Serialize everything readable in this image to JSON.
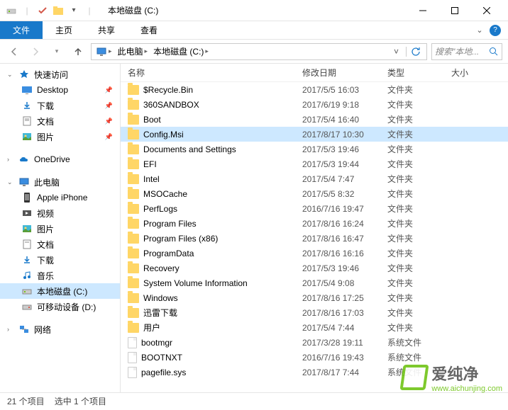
{
  "titlebar": {
    "title": "本地磁盘 (C:)",
    "min_tip": "最小化",
    "max_tip": "最大化",
    "close_tip": "关闭"
  },
  "ribbon": {
    "file": "文件",
    "home": "主页",
    "share": "共享",
    "view": "查看"
  },
  "path": {
    "seg1": "此电脑",
    "seg2": "本地磁盘 (C:)"
  },
  "search_placeholder": "搜索\"本地...",
  "nav": {
    "quick": "快速访问",
    "desktop": "Desktop",
    "downloads": "下载",
    "documents": "文档",
    "pictures": "图片",
    "onedrive": "OneDrive",
    "thispc": "此电脑",
    "apple": "Apple iPhone",
    "videos": "视频",
    "pictures2": "图片",
    "documents2": "文档",
    "downloads2": "下载",
    "music": "音乐",
    "cdrive": "本地磁盘 (C:)",
    "ddrive": "可移动设备 (D:)",
    "network": "网络"
  },
  "columns": {
    "name": "名称",
    "date": "修改日期",
    "type": "类型",
    "size": "大小"
  },
  "files": [
    {
      "name": "$Recycle.Bin",
      "date": "2017/5/5 16:03",
      "type": "文件夹",
      "icon": "folder"
    },
    {
      "name": "360SANDBOX",
      "date": "2017/6/19 9:18",
      "type": "文件夹",
      "icon": "folder"
    },
    {
      "name": "Boot",
      "date": "2017/5/4 16:40",
      "type": "文件夹",
      "icon": "folder"
    },
    {
      "name": "Config.Msi",
      "date": "2017/8/17 10:30",
      "type": "文件夹",
      "icon": "folder",
      "selected": true
    },
    {
      "name": "Documents and Settings",
      "date": "2017/5/3 19:46",
      "type": "文件夹",
      "icon": "folder"
    },
    {
      "name": "EFI",
      "date": "2017/5/3 19:44",
      "type": "文件夹",
      "icon": "folder"
    },
    {
      "name": "Intel",
      "date": "2017/5/4 7:47",
      "type": "文件夹",
      "icon": "folder"
    },
    {
      "name": "MSOCache",
      "date": "2017/5/5 8:32",
      "type": "文件夹",
      "icon": "folder"
    },
    {
      "name": "PerfLogs",
      "date": "2016/7/16 19:47",
      "type": "文件夹",
      "icon": "folder"
    },
    {
      "name": "Program Files",
      "date": "2017/8/16 16:24",
      "type": "文件夹",
      "icon": "folder"
    },
    {
      "name": "Program Files (x86)",
      "date": "2017/8/16 16:47",
      "type": "文件夹",
      "icon": "folder"
    },
    {
      "name": "ProgramData",
      "date": "2017/8/16 16:16",
      "type": "文件夹",
      "icon": "folder"
    },
    {
      "name": "Recovery",
      "date": "2017/5/3 19:46",
      "type": "文件夹",
      "icon": "folder"
    },
    {
      "name": "System Volume Information",
      "date": "2017/5/4 9:08",
      "type": "文件夹",
      "icon": "folder"
    },
    {
      "name": "Windows",
      "date": "2017/8/16 17:25",
      "type": "文件夹",
      "icon": "folder"
    },
    {
      "name": "迅雷下载",
      "date": "2017/8/16 17:03",
      "type": "文件夹",
      "icon": "folder"
    },
    {
      "name": "用户",
      "date": "2017/5/4 7:44",
      "type": "文件夹",
      "icon": "folder"
    },
    {
      "name": "bootmgr",
      "date": "2017/3/28 19:11",
      "type": "系统文件",
      "icon": "file"
    },
    {
      "name": "BOOTNXT",
      "date": "2016/7/16 19:43",
      "type": "系统文件",
      "icon": "file"
    },
    {
      "name": "pagefile.sys",
      "date": "2017/8/17 7:44",
      "type": "系统文件",
      "icon": "file"
    }
  ],
  "status": {
    "count": "21 个项目",
    "selected": "选中 1 个项目"
  },
  "watermark": {
    "text": "爱纯净",
    "url": "www.aichunjing.com"
  }
}
